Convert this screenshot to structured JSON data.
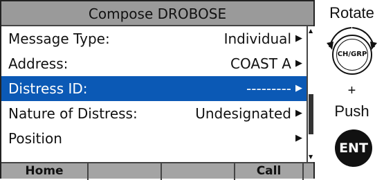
{
  "screen": {
    "title": "Compose DROBOSE",
    "rows": [
      {
        "label": "Message Type:",
        "value": "Individual"
      },
      {
        "label": "Address:",
        "value": "COAST A"
      },
      {
        "label": "Distress ID:",
        "value": "---------"
      },
      {
        "label": "Nature of Distress:",
        "value": "Undesignated"
      },
      {
        "label": "Position",
        "value": ""
      }
    ],
    "selected_row": 2,
    "softkeys": [
      "Home",
      "",
      "",
      "Call"
    ]
  },
  "side": {
    "rotate_label": "Rotate",
    "knob_label": "CH/GRP",
    "plus": "+",
    "push_label": "Push",
    "ent_label": "ENT"
  },
  "colors": {
    "selection": "#0b59b5",
    "title_bar": "#9a9a9a",
    "softkey_bar": "#a4a4a4"
  }
}
